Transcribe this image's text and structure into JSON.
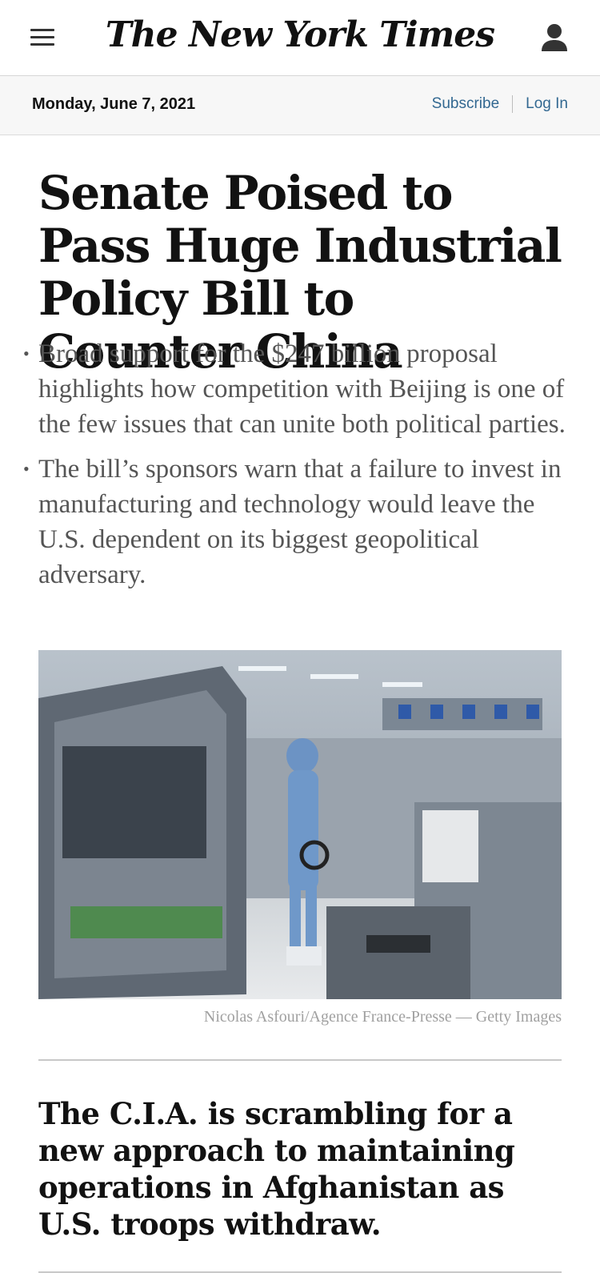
{
  "header": {
    "menu_icon": "hamburger-menu-icon",
    "logo_text": "The New York Times",
    "user_icon": "user-account-icon"
  },
  "datebar": {
    "date": "Monday, June 7, 2021",
    "subscribe_label": "Subscribe",
    "login_label": "Log In",
    "link_color": "#326891"
  },
  "article": {
    "headline": "Senate Poised to Pass Huge Industrial Policy Bill to Counter China",
    "summary": [
      "Broad support for the $247 billion proposal highlights how competition with Beijing is one of the few issues that can unite both political parties.",
      "The bill’s sponsors warn that a failure to invest in manufacturing and technology would leave the U.S. dependent on its biggest geopolitical adversary."
    ],
    "photo_credit": "Nicolas Asfouri/Agence France-Presse — Getty Images"
  },
  "next_story": {
    "headline": "The C.I.A. is scrambling for a new approach to maintaining operations in Afghanistan as U.S. troops withdraw."
  }
}
